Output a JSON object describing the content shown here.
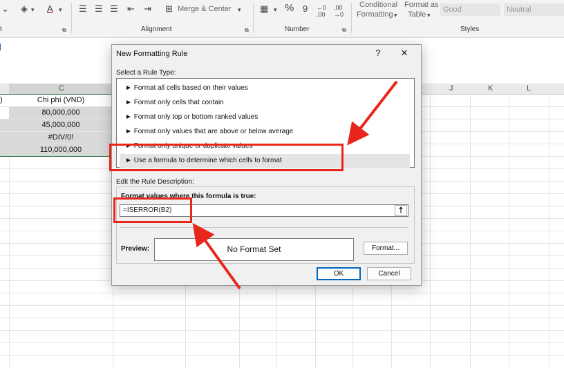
{
  "ribbon": {
    "merge_center": "Merge & Center",
    "conditional_formatting_line1": "Conditional",
    "conditional_formatting_line2": "Formatting",
    "format_as_table_line1": "Format as",
    "format_as_table_line2": "Table",
    "style_good": "Good",
    "style_neutral": "Neutral",
    "group_alignment": "Alignment",
    "group_number": "Number",
    "group_styles": "Styles",
    "group_font_partial": "t",
    "percent_symbol": "%",
    "comma_symbol": "9"
  },
  "sheet": {
    "column_c": "C",
    "column_j": "J",
    "column_k": "K",
    "column_l": "L",
    "partial_header": ")",
    "header_c": "Chi phí (VND)",
    "values": [
      "80,000,000",
      "45,000,000",
      "#DIV/0!",
      "110,000,000"
    ]
  },
  "dialog": {
    "title": "New Formatting Rule",
    "help": "?",
    "close": "✕",
    "select_rule_type_label": "Select a Rule Type:",
    "rule_types": [
      "Format all cells based on their values",
      "Format only cells that contain",
      "Format only top or bottom ranked values",
      "Format only values that are above or below average",
      "Format only unique or duplicate values",
      "Use a formula to determine which cells to format"
    ],
    "edit_description_label": "Edit the Rule Description:",
    "formula_label": "Format values where this formula is true:",
    "formula_value": "=ISERROR(B2)",
    "preview_label": "Preview:",
    "preview_text": "No Format Set",
    "format_button": "Format...",
    "ok_button": "OK",
    "cancel_button": "Cancel"
  },
  "colors": {
    "annotation_red": "#e8261c",
    "selected_fill": "#d9d9d9",
    "excel_green": "#1e6b3c"
  }
}
